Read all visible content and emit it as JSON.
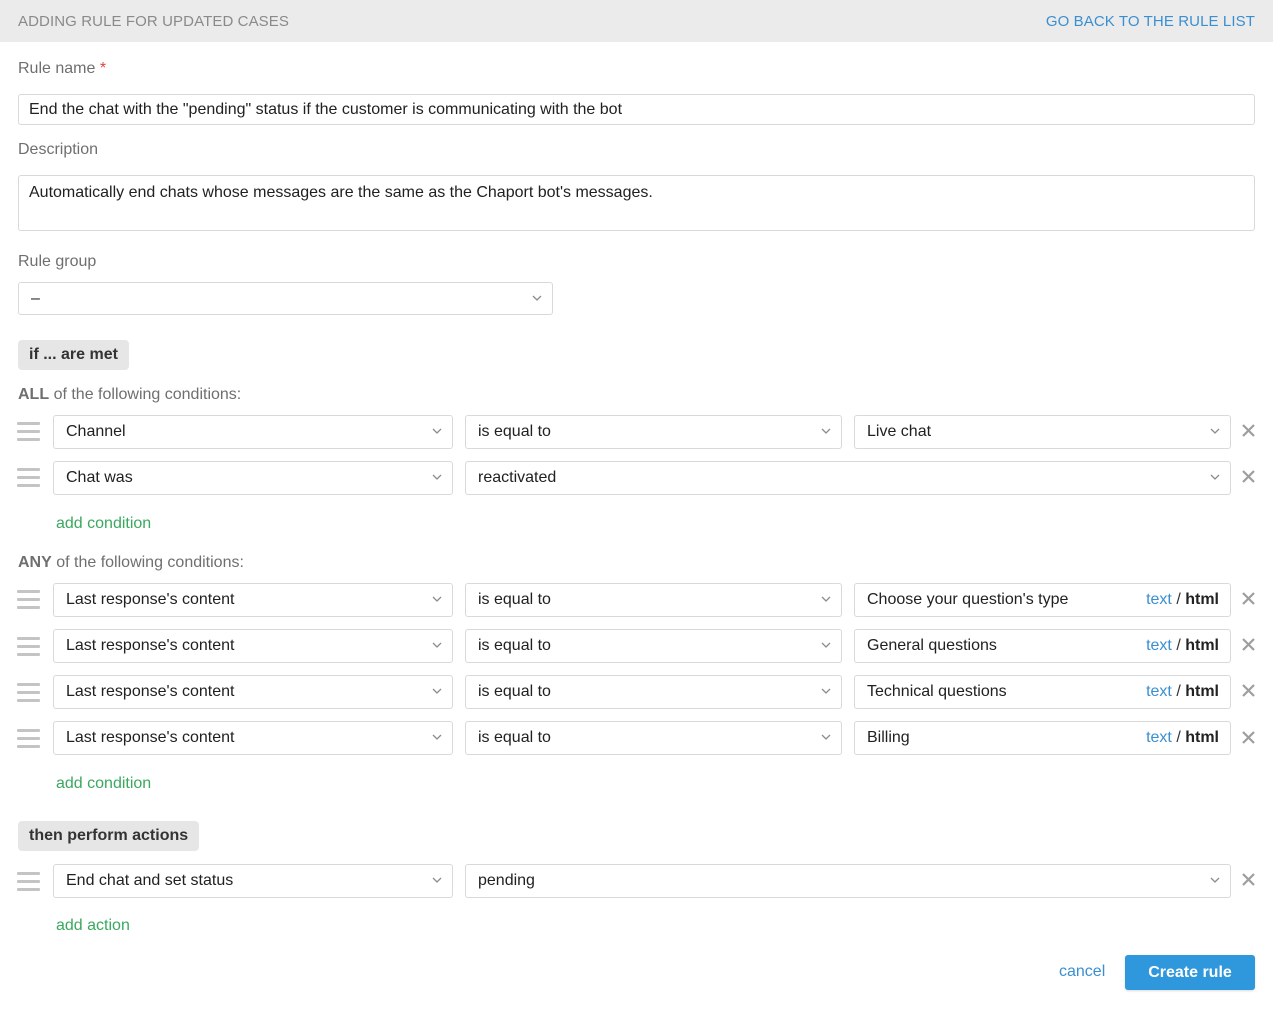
{
  "header": {
    "title": "ADDING RULE FOR UPDATED CASES",
    "back_link": "GO BACK TO THE RULE LIST"
  },
  "form": {
    "rule_name_label": "Rule name",
    "required_mark": "*",
    "rule_name_value": "End the chat with the \"pending\" status if the customer is communicating with the bot",
    "description_label": "Description",
    "description_value": "Automatically end chats whose messages are the same as the Chaport bot's messages.",
    "rule_group_label": "Rule group",
    "rule_group_value": "–"
  },
  "conditions": {
    "section_label": "if ... are met",
    "all_keyword": "ALL",
    "all_suffix": "of the following conditions:",
    "all_rows": [
      {
        "field": "Channel",
        "operator": "is equal to",
        "value": "Live chat"
      },
      {
        "field": "Chat was",
        "operator": "reactivated"
      }
    ],
    "any_keyword": "ANY",
    "any_suffix": "of the following conditions:",
    "any_rows": [
      {
        "field": "Last response's content",
        "operator": "is equal to",
        "value": "Choose your question's type"
      },
      {
        "field": "Last response's content",
        "operator": "is equal to",
        "value": "General questions"
      },
      {
        "field": "Last response's content",
        "operator": "is equal to",
        "value": "Technical questions"
      },
      {
        "field": "Last response's content",
        "operator": "is equal to",
        "value": "Billing"
      }
    ],
    "format_text": "text",
    "format_sep": "/",
    "format_html": "html",
    "add_condition_label": "add condition"
  },
  "actions": {
    "section_label": "then perform actions",
    "rows": [
      {
        "action": "End chat and set status",
        "value": "pending"
      }
    ],
    "add_action_label": "add action"
  },
  "footer": {
    "cancel_label": "cancel",
    "create_label": "Create rule"
  },
  "colors": {
    "accent_blue": "#2f97dc",
    "link_blue": "#3a8fd1",
    "add_green": "#3aa85e",
    "required_red": "#e04444"
  }
}
